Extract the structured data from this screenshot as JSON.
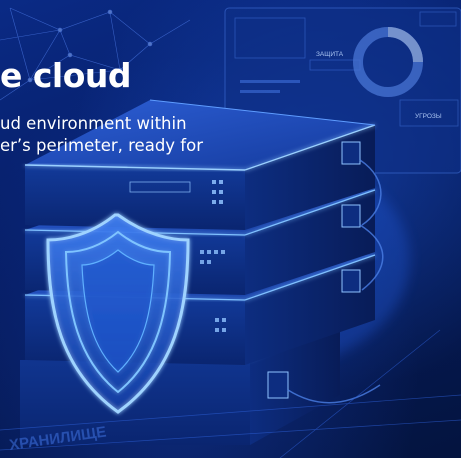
{
  "hero": {
    "headline": "e cloud",
    "subtitle_line1": "ud environment within",
    "subtitle_line2": "er’s perimeter, ready for"
  },
  "scene": {
    "panel_label_protection": "ЗАЩИТА",
    "panel_label_threats": "УГРОЗЫ",
    "floor_label_storage": "ХРАНИЛИЩЕ"
  },
  "colors": {
    "background": "#061d63",
    "accent_glow": "#4aa3ff",
    "shield": "#7fc4ff",
    "text": "#ffffff"
  }
}
